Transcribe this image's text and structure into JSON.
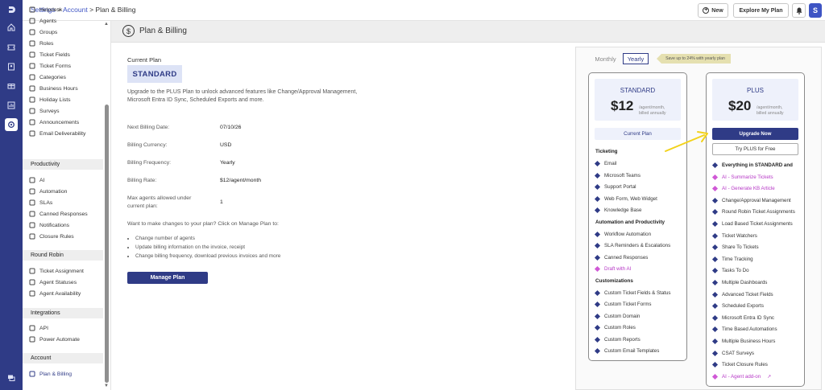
{
  "header": {
    "breadcrumb": {
      "root": "Settings",
      "sep1": ">",
      "mid": "Account",
      "sep2": ">",
      "current": "Plan & Billing"
    },
    "new_label": "New",
    "explore_label": "Explore My Plan",
    "avatar_letter": "S"
  },
  "rail": {
    "icons": [
      "logo-icon",
      "home-icon",
      "ticket-icon",
      "contacts-icon",
      "gift-icon",
      "reports-icon",
      "settings-icon",
      "chat-icon"
    ]
  },
  "sidebar": {
    "top_items": [
      {
        "label": "Helpdesk",
        "icon": "helpdesk-icon"
      },
      {
        "label": "Agents",
        "icon": "agents-icon"
      },
      {
        "label": "Groups",
        "icon": "groups-icon"
      },
      {
        "label": "Roles",
        "icon": "roles-icon"
      },
      {
        "label": "Ticket Fields",
        "icon": "ticket-fields-icon"
      },
      {
        "label": "Ticket Forms",
        "icon": "ticket-forms-icon"
      },
      {
        "label": "Categories",
        "icon": "categories-icon"
      },
      {
        "label": "Business Hours",
        "icon": "business-hours-icon"
      },
      {
        "label": "Holiday Lists",
        "icon": "holiday-lists-icon"
      },
      {
        "label": "Surveys",
        "icon": "surveys-icon"
      },
      {
        "label": "Announcements",
        "icon": "announcements-icon"
      },
      {
        "label": "Email Deliverability",
        "icon": "email-icon"
      }
    ],
    "sections": {
      "productivity": "Productivity",
      "round_robin": "Round Robin",
      "integrations": "Integrations",
      "account": "Account"
    },
    "productivity_items": [
      {
        "label": "AI"
      },
      {
        "label": "Automation"
      },
      {
        "label": "SLAs"
      },
      {
        "label": "Canned Responses"
      },
      {
        "label": "Notifications"
      },
      {
        "label": "Closure Rules"
      }
    ],
    "round_robin_items": [
      {
        "label": "Ticket Assignment"
      },
      {
        "label": "Agent Statuses"
      },
      {
        "label": "Agent Availability"
      }
    ],
    "integrations_items": [
      {
        "label": "API"
      },
      {
        "label": "Power Automate"
      }
    ],
    "account_items": [
      {
        "label": "Plan & Billing"
      }
    ]
  },
  "page": {
    "title": "Plan & Billing",
    "current_plan_label": "Current Plan",
    "current_plan_name": "STANDARD",
    "upgrade_text": "Upgrade to the PLUS Plan to unlock advanced features like Change/Approval Management, Microsoft Entra ID Sync, Scheduled Exports and more.",
    "details": [
      {
        "label": "Next Billing Date:",
        "value": "07/10/26"
      },
      {
        "label": "Billing Currency:",
        "value": "USD"
      },
      {
        "label": "Billing Frequency:",
        "value": "Yearly"
      },
      {
        "label": "Billing Rate:",
        "value": "$12/agent/month"
      }
    ],
    "max_agents_label_1": "Max agents allowed under",
    "max_agents_label_2": "current plan:",
    "max_agents_value": "1",
    "change_prompt": "Want to make changes to your plan? Click on Manage Plan to:",
    "change_bullets": [
      "Change number of agents",
      "Update billing information on the invoice, receipt",
      "Change billing frequency, download previous invoices and more"
    ],
    "manage_label": "Manage Plan"
  },
  "pricing": {
    "monthly_label": "Monthly",
    "yearly_label": "Yearly",
    "selected": "Yearly",
    "save_tag": "Save up to 24% with yearly plan",
    "standard": {
      "name": "STANDARD",
      "price": "$12",
      "per_1": "/agent/month,",
      "per_2": "billed annually",
      "button": "Current Plan",
      "groups": [
        {
          "title": "Ticketing",
          "items": [
            "Email",
            "Microsoft Teams",
            "Support Portal",
            "Web Form, Web Widget",
            "Knowledge Base"
          ]
        },
        {
          "title": "Automation and Productivity",
          "items": [
            "Workflow Automation",
            "SLA Reminders & Escalations",
            "Canned Responses",
            "Draft with AI"
          ]
        },
        {
          "title": "Customizations",
          "items": [
            "Custom Ticket Fields & Status",
            "Custom Ticket Forms",
            "Custom Domain",
            "Custom Roles",
            "Custom Reports",
            "Custom Email Templates"
          ]
        }
      ]
    },
    "plus": {
      "name": "PLUS",
      "price": "$20",
      "per_1": "/agent/month,",
      "per_2": "billed annually",
      "upgrade_button": "Upgrade Now",
      "try_button": "Try PLUS for Free",
      "items": [
        "Everything in STANDARD and",
        "AI - Summarize Tickets",
        "AI - Generate KB Article",
        "Change/Approval Management",
        "Round Robin Ticket Assignments",
        "Load Based Ticket Assignments",
        "Ticket Watchers",
        "Share To Tickets",
        "Time Tracking",
        "Tasks To Do",
        "Multiple Dashboards",
        "Advanced Ticket Fields",
        "Scheduled Exports",
        "Microsoft Entra ID Sync",
        "Time Based Automations",
        "Multiple Business Hours",
        "CSAT Surveys",
        "Ticket Closure Rules",
        "AI - Agent add-on"
      ]
    },
    "colors": {
      "brand": "#2f3b86",
      "ai": "#b637c6",
      "arrow": "#f2d21b"
    }
  }
}
